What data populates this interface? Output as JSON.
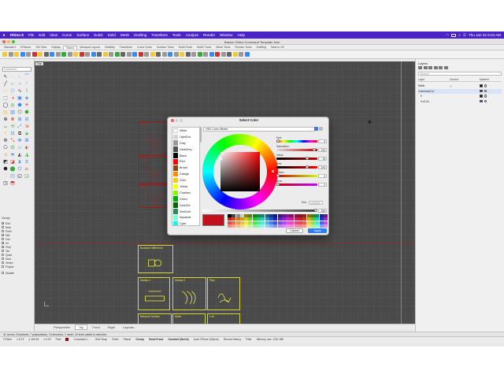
{
  "menubar": {
    "app": "Rhino 8",
    "items": [
      "File",
      "Edit",
      "View",
      "Curve",
      "Surface",
      "SubD",
      "Solid",
      "Mesh",
      "Drafting",
      "Transform",
      "Tools",
      "Analyze",
      "Render",
      "Window",
      "Help"
    ],
    "clock": "Thu Jan 22  8:23 AM",
    "bg": "#4a23c6"
  },
  "window": {
    "title": "Basics: Rhino Command Template 3dm"
  },
  "toptabs": [
    "Standard",
    "CPlanes",
    "Set View",
    "Display",
    "Select",
    "Viewport Layout",
    "Visibility",
    "Transform",
    "Curve Tools",
    "Surface Tools",
    "Solid Tools",
    "SubD Tools",
    "Mesh Tools",
    "Render Tools",
    "Drafting",
    "New in V8"
  ],
  "toptabs_active": "Select",
  "left": {
    "command_placeholder": "Command",
    "osnap_title": "Osnap",
    "osnaps": [
      {
        "label": "End",
        "on": true
      },
      {
        "label": "Near",
        "on": false
      },
      {
        "label": "Point",
        "on": false
      },
      {
        "label": "Mid",
        "on": true
      },
      {
        "label": "Cen",
        "on": false
      },
      {
        "label": "Int",
        "on": true
      },
      {
        "label": "Perp",
        "on": true
      },
      {
        "label": "Tan",
        "on": false
      },
      {
        "label": "Quad",
        "on": false
      },
      {
        "label": "Knot",
        "on": false
      },
      {
        "label": "Vertex",
        "on": false
      },
      {
        "label": "Project",
        "on": false
      },
      {
        "label": "Disable",
        "on": false
      }
    ]
  },
  "viewport": {
    "label": "Top",
    "panes_red": [
      {
        "label": "Fillet"
      },
      {
        "label": "Extend"
      },
      {
        "label": "Trim"
      },
      {
        "label": "Rebuild"
      },
      {
        "label": "Offset"
      },
      {
        "label": "Array"
      }
    ],
    "panes_yellow": [
      {
        "label": "Boolean Difference"
      },
      {
        "label": "Sweep 1"
      },
      {
        "label": "Sweep 2"
      },
      {
        "label": "Pipe"
      },
      {
        "label": "Network Surface"
      },
      {
        "label": "Mesh"
      },
      {
        "label": "Loft"
      }
    ],
    "tabs": [
      "Perspective",
      "Top",
      "Front",
      "Right",
      "Layouts..."
    ],
    "active_tab": "Top"
  },
  "layers": {
    "title": "Layers",
    "search_placeholder": "Search",
    "headers": [
      "Layer",
      "Current",
      "Material"
    ],
    "rows": [
      {
        "name": "Walls",
        "current": true,
        "color": "#111111"
      },
      {
        "name": "Command Le",
        "current": false,
        "color": "#8a1111"
      },
      {
        "name": "0",
        "current": false,
        "color": "#111111"
      },
      {
        "name": "4-r0.A1",
        "current": false,
        "color": "#2a50d0"
      }
    ]
  },
  "status": {
    "selection": "41 curves, 8 surfaces, 7 polysurfaces, 3 extrusions, 1 mesh, 20 texts added to selection.",
    "cplane": "CPlane",
    "x": "x 8.74",
    "y": "y 163.40",
    "z": "z 0.00",
    "units": "Feet",
    "layer": "Command L...",
    "toggles": [
      "Grid Snap",
      "Ortho",
      "Planar",
      "Osnap",
      "SmartTrack",
      "Gumball (World)",
      "Auto CPlane (Object)",
      "Record History",
      "Filter"
    ],
    "bold_toggles": [
      "Osnap",
      "SmartTrack",
      "Gumball (World)"
    ],
    "memory": "Memory use: 1201 MB",
    "layer_color": "#8a1111"
  },
  "dialog": {
    "title": "Select Color",
    "colors": [
      {
        "name": "White",
        "hex": "#ffffff"
      },
      {
        "name": "LightGra",
        "hex": "#d3d3d3"
      },
      {
        "name": "Gray",
        "hex": "#9a9a9a"
      },
      {
        "name": "DarkGrey",
        "hex": "#505050"
      },
      {
        "name": "Black",
        "hex": "#000000"
      },
      {
        "name": "Red",
        "hex": "#ff0000"
      },
      {
        "name": "Brown",
        "hex": "#8b4513"
      },
      {
        "name": "Orange",
        "hex": "#ff8c00"
      },
      {
        "name": "Gold",
        "hex": "#ffc61a"
      },
      {
        "name": "Yellow",
        "hex": "#ffff00"
      },
      {
        "name": "Chartreu",
        "hex": "#7fff00"
      },
      {
        "name": "Green",
        "hex": "#00b000"
      },
      {
        "name": "DarkGre",
        "hex": "#006400"
      },
      {
        "name": "SeaGree",
        "hex": "#2e8b57"
      },
      {
        "name": "Aquamar",
        "hex": "#7fffd4"
      },
      {
        "name": "Cyan",
        "hex": "#00ffff"
      }
    ],
    "mode": "HSV Color Wheel",
    "sliders": [
      {
        "label": "Hue:",
        "value": "0",
        "fraction": 0.0
      },
      {
        "label": "Saturation:",
        "value": "100",
        "fraction": 0.95
      },
      {
        "label": "Value:",
        "value": "78",
        "fraction": 0.78
      },
      {
        "label": "Red:",
        "value": "200",
        "fraction": 0.78
      },
      {
        "label": "Green:",
        "value": "0",
        "fraction": 0.0
      },
      {
        "label": "Blue:",
        "value": "0",
        "fraction": 0.0
      }
    ],
    "hex_label": "Hex:",
    "hex_value": "#C80000",
    "alpha_value": "255",
    "preview_color": "#c1121b",
    "cancel": "Cancel",
    "apply": "Apply"
  }
}
